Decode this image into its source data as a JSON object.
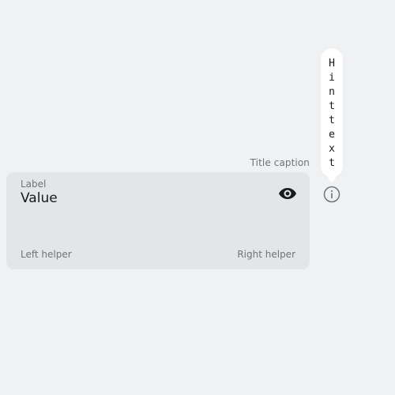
{
  "field": {
    "title_caption": "Title caption",
    "label": "Label",
    "value": "Value",
    "helper_left": "Left helper",
    "helper_right": "Right helper",
    "action_icon": "eye-icon"
  },
  "hint": {
    "icon": "info-icon",
    "text": "Hinttext"
  },
  "colors": {
    "background": "#f0f1f3",
    "field_background": "#e4e5e7",
    "secondary_text": "#6f7378",
    "primary_text": "#17191c",
    "tooltip_background": "#ffffff"
  }
}
